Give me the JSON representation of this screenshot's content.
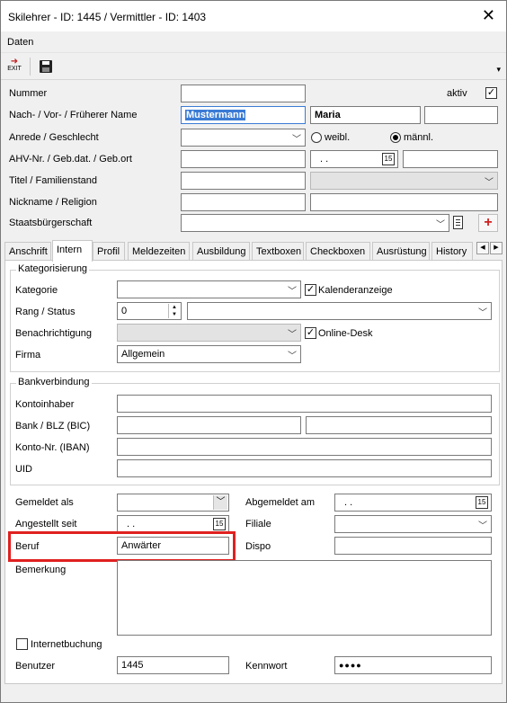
{
  "window": {
    "title": "Skilehrer - ID: 1445 / Vermittler - ID: 1403"
  },
  "menu": {
    "daten": "Daten"
  },
  "toolbar": {
    "exit_label": "EXIT",
    "scroll_arrow": "▾"
  },
  "header": {
    "nummer_label": "Nummer",
    "aktiv_label": "aktiv",
    "aktiv_checked": true,
    "name_label": "Nach- / Vor- / Früherer Name",
    "nachname": "Mustermann",
    "vorname": "Maria",
    "frueherer_name": "",
    "anrede_label": "Anrede / Geschlecht",
    "weibl_label": "weibl.",
    "maennl_label": "männl.",
    "geschlecht": "männl.",
    "ahv_label": "AHV-Nr. / Geb.dat. / Geb.ort",
    "gebdat_value": ". .",
    "titel_label": "Titel / Familienstand",
    "nickname_label": "Nickname  / Religion",
    "staat_label": "Staatsbürgerschaft"
  },
  "tabs": [
    "Anschrift",
    "Intern",
    "Profil",
    "Meldezeiten",
    "Ausbildung",
    "Textboxen",
    "Checkboxen",
    "Ausrüstung",
    "History"
  ],
  "active_tab": "Intern",
  "kategorisierung": {
    "title": "Kategorisierung",
    "kategorie_label": "Kategorie",
    "kalender_label": "Kalenderanzeige",
    "kalender_checked": true,
    "rang_label": "Rang / Status",
    "rang_value": "0",
    "benachrichtigung_label": "Benachrichtigung",
    "online_label": "Online-Desk",
    "online_checked": true,
    "firma_label": "Firma",
    "firma_value": "Allgemein"
  },
  "bank": {
    "title": "Bankverbindung",
    "kontoinhaber_label": "Kontoinhaber",
    "blz_label": "Bank / BLZ (BIC)",
    "iban_label": "Konto-Nr. (IBAN)",
    "uid_label": "UID"
  },
  "lower": {
    "gemeldet_label": "Gemeldet als",
    "abgemeldet_label": "Abgemeldet am",
    "abgemeldet_value": ". .",
    "angestellt_label": "Angestellt seit",
    "angestellt_value": ". .",
    "filiale_label": "Filiale",
    "beruf_label": "Beruf",
    "beruf_value": "Anwärter",
    "dispo_label": "Dispo",
    "bemerkung_label": "Bemerkung",
    "internet_label": "Internetbuchung",
    "internet_checked": false,
    "benutzer_label": "Benutzer",
    "benutzer_value": "1445",
    "kennwort_label": "Kennwort",
    "kennwort_value": "●●●●"
  },
  "icons": {
    "calendar": "15",
    "plus": "+",
    "check": "✓"
  },
  "colors": {
    "highlight": "#e02020",
    "selection": "#3a7bd5",
    "plus": "#d02020"
  }
}
